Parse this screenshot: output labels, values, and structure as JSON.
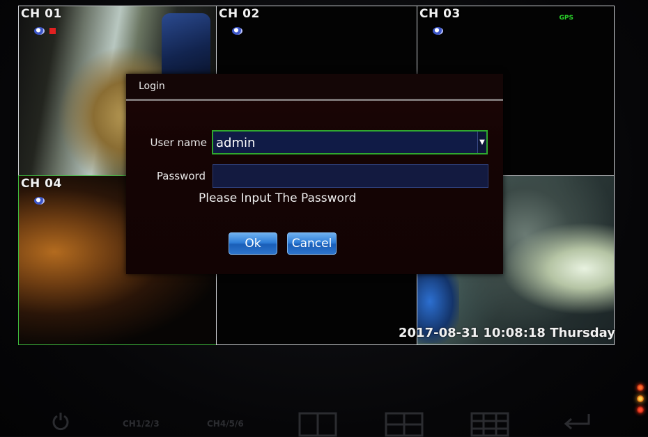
{
  "channels": [
    {
      "label": "CH 01"
    },
    {
      "label": "CH 02"
    },
    {
      "label": "CH 03",
      "gps": "GPS"
    },
    {
      "label": "CH 04"
    }
  ],
  "timestamp": "2017-08-31 10:08:18 Thursday",
  "dialog": {
    "title": "Login",
    "username_label": "User name",
    "username_value": "admin",
    "password_label": "Password",
    "password_value": "",
    "hint": "Please Input The Password",
    "ok_label": "Ok",
    "cancel_label": "Cancel"
  },
  "bezel": {
    "buttons": [
      "CH1/2/3",
      "CH4/5/6"
    ]
  },
  "colors": {
    "active_border": "#3fbf3f",
    "button_blue": "#2f7ed8",
    "input_bg": "#101b46"
  },
  "icons": [
    "record-icon",
    "alarm-icon",
    "power-icon",
    "split-2-icon",
    "split-4-icon",
    "split-9-icon",
    "return-icon",
    "dropdown-arrow-icon"
  ]
}
